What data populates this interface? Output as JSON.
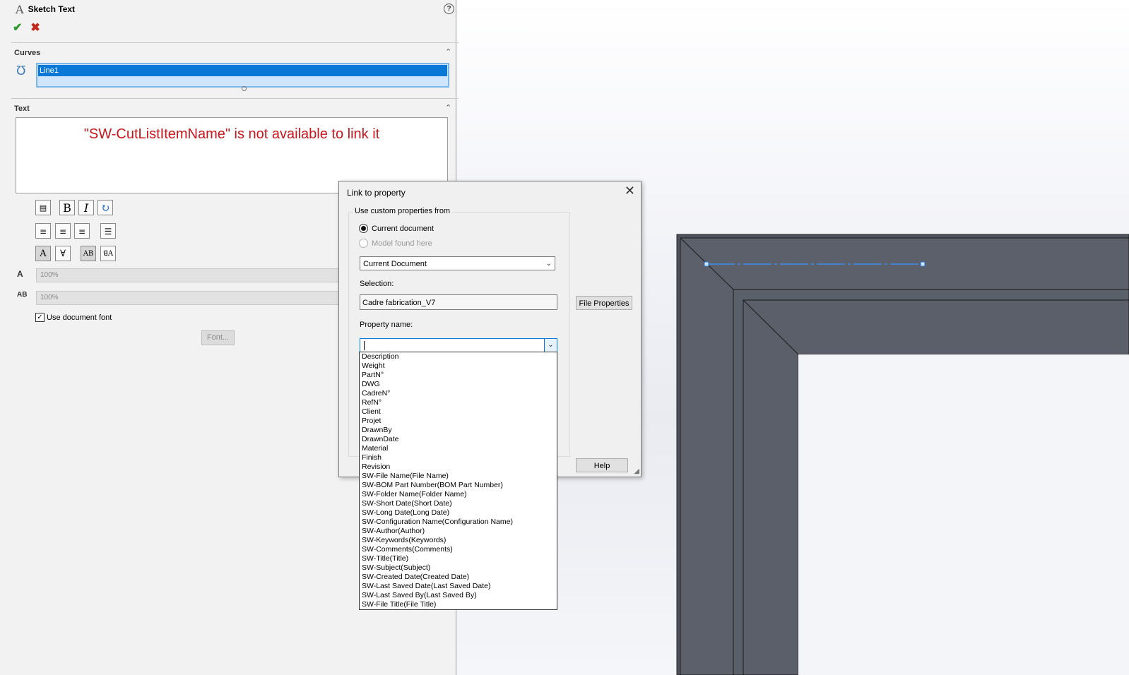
{
  "panel": {
    "title": "Sketch Text",
    "curves_section": "Curves",
    "curve_item": "Line1",
    "text_section": "Text",
    "text_content": "\"SW-CutListItemName\" is not available to link it",
    "width_factor": "100%",
    "spacing": "100%",
    "use_document_font": "Use document font",
    "font_button": "Font..."
  },
  "dialog": {
    "title": "Link to property",
    "group_label": "Use custom properties from",
    "radio_current": "Current document",
    "radio_model": "Model found here",
    "source_combo": "Current Document",
    "selection_label": "Selection:",
    "selection_value": "Cadre fabrication_V7",
    "file_properties_button": "File Properties",
    "property_name_label": "Property name:",
    "help_button": "Help"
  },
  "property_options": [
    "Description",
    "Weight",
    "PartN°",
    "DWG",
    "CadreN°",
    "RefN°",
    "Client",
    "Projet",
    "DrawnBy",
    "DrawnDate",
    "Material",
    "Finish",
    "Revision",
    "SW-File Name(File Name)",
    "SW-BOM Part Number(BOM Part Number)",
    "SW-Folder Name(Folder Name)",
    "SW-Short Date(Short Date)",
    "SW-Long Date(Long Date)",
    "SW-Configuration Name(Configuration Name)",
    "SW-Author(Author)",
    "SW-Keywords(Keywords)",
    "SW-Comments(Comments)",
    "SW-Title(Title)",
    "SW-Subject(Subject)",
    "SW-Created Date(Created Date)",
    "SW-Last Saved Date(Last Saved Date)",
    "SW-Last Saved By(Last Saved By)",
    "SW-File Title(File Title)"
  ],
  "colors": {
    "accent": "#0a78d7",
    "warning_text": "#c8161d",
    "model_face": "#5a5f6b",
    "sketch_line": "#3d8ee6"
  }
}
